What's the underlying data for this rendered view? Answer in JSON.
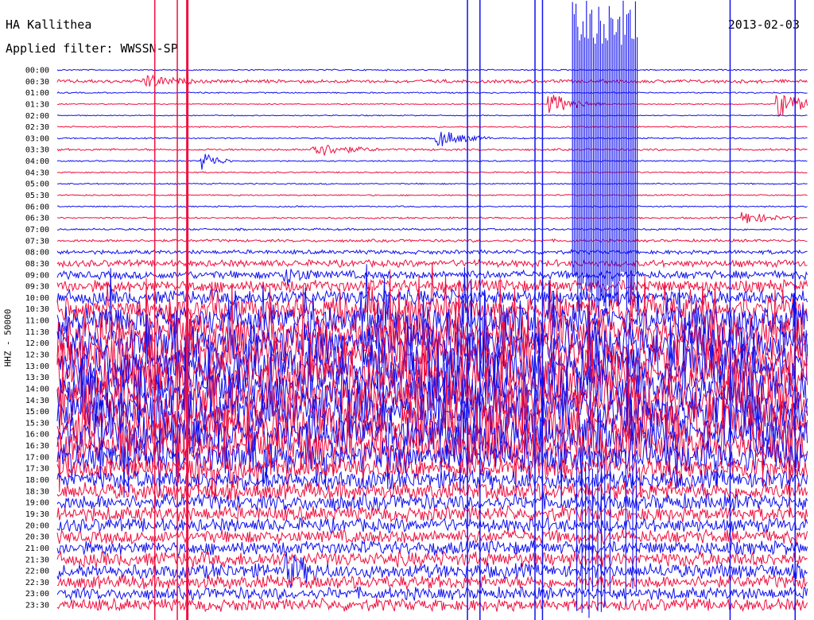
{
  "header": {
    "station": "HA Kallithea",
    "date": "2013-02-03",
    "filter": "Applied filter: WWSSN-SP"
  },
  "chart_data": {
    "type": "line",
    "chart_kind": "helicorder seismogram",
    "ylabel": "HHZ - 50000",
    "rows": [
      "00:00",
      "00:30",
      "01:00",
      "01:30",
      "02:00",
      "02:30",
      "03:00",
      "03:30",
      "04:00",
      "04:30",
      "05:00",
      "05:30",
      "06:00",
      "06:30",
      "07:00",
      "07:30",
      "08:00",
      "08:30",
      "09:00",
      "09:30",
      "10:00",
      "10:30",
      "11:00",
      "11:30",
      "12:00",
      "12:30",
      "13:00",
      "13:30",
      "14:00",
      "14:30",
      "15:00",
      "15:30",
      "16:00",
      "16:30",
      "17:00",
      "17:30",
      "18:00",
      "18:30",
      "19:00",
      "19:30",
      "20:00",
      "20:30",
      "21:00",
      "21:30",
      "22:00",
      "22:30",
      "23:00",
      "23:30"
    ],
    "row_minutes": 30,
    "trace_colors": [
      "#1010ee",
      "#ee1040"
    ],
    "noise_level": [
      0.1,
      0.25,
      0.1,
      0.08,
      0.08,
      0.1,
      0.1,
      0.15,
      0.1,
      0.1,
      0.1,
      0.1,
      0.1,
      0.12,
      0.15,
      0.2,
      0.3,
      0.5,
      0.6,
      0.9,
      1.1,
      1.6,
      2.2,
      2.6,
      2.8,
      3.0,
      3.0,
      3.0,
      3.0,
      3.0,
      3.0,
      3.0,
      2.8,
      2.6,
      2.2,
      1.6,
      1.4,
      1.3,
      1.2,
      1.1,
      1.0,
      1.0,
      1.0,
      1.1,
      1.1,
      1.0,
      0.9,
      0.9
    ],
    "events": [
      {
        "row": 1,
        "minute": 3.7,
        "amplitude": 1.0,
        "duration": 2
      },
      {
        "row": 3,
        "minute": 19.9,
        "amplitude": 1.6,
        "duration": 2
      },
      {
        "row": 3,
        "minute": 29.0,
        "amplitude": 2.0,
        "duration": 2
      },
      {
        "row": 6,
        "minute": 15.4,
        "amplitude": 1.4,
        "duration": 2
      },
      {
        "row": 7,
        "minute": 10.4,
        "amplitude": 1.2,
        "duration": 2.5
      },
      {
        "row": 8,
        "minute": 6.0,
        "amplitude": 1.5,
        "duration": 1
      },
      {
        "row": 10,
        "minute": 30.4,
        "amplitude": 2.0,
        "duration": 1
      },
      {
        "row": 13,
        "minute": 27.6,
        "amplitude": 1.0,
        "duration": 2
      },
      {
        "row": 18,
        "minute": 9.2,
        "amplitude": 1.2,
        "duration": 1.5
      },
      {
        "row": 44,
        "minute": 9.4,
        "amplitude": 2.0,
        "duration": 1.5
      }
    ],
    "spikes": [
      {
        "minute": 3.9,
        "top": 0.0,
        "bottom": 780.0,
        "color": "#ee1040"
      },
      {
        "minute": 5.2,
        "top": 0.0,
        "bottom": 780.0,
        "color": "#ee1040"
      },
      {
        "minute": 4.8,
        "top": 0.0,
        "bottom": 780.0,
        "color": "#ee1040"
      },
      {
        "minute": 16.4,
        "top": 0.0,
        "bottom": 780.0,
        "color": "#1010ee"
      },
      {
        "minute": 16.9,
        "top": 0.0,
        "bottom": 780.0,
        "color": "#1010ee"
      },
      {
        "minute": 19.1,
        "top": 0.0,
        "bottom": 780.0,
        "color": "#1010ee"
      },
      {
        "minute": 19.4,
        "top": 0.0,
        "bottom": 780.0,
        "color": "#1010ee"
      },
      {
        "minute": 26.9,
        "top": 0.0,
        "bottom": 780.0,
        "color": "#1010ee"
      },
      {
        "minute": 29.5,
        "top": 0.0,
        "bottom": 780.0,
        "color": "#1010ee"
      },
      {
        "minute": 30.3,
        "top": 0.0,
        "bottom": 780.0,
        "color": "#1010ee"
      }
    ],
    "burst": {
      "minute_start": 20.6,
      "minute_end": 23.2,
      "color": "#1010ee"
    }
  }
}
